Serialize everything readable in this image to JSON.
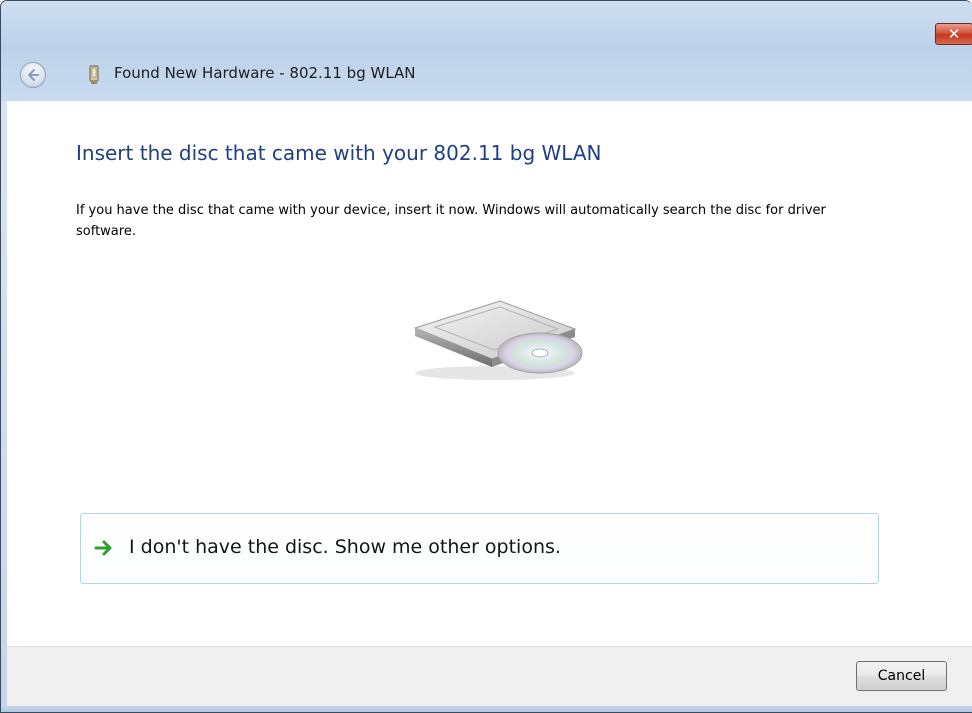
{
  "window": {
    "title": "Found New Hardware - 802.11 bg WLAN",
    "close_label": "x"
  },
  "main": {
    "heading": "Insert the disc that came with your 802.11 bg WLAN",
    "description": "If you have the disc that came with your device, insert it now.  Windows will automatically search the disc for driver software.",
    "option_label": "I don't have the disc.  Show me other options."
  },
  "footer": {
    "cancel_label": "Cancel"
  },
  "icons": {
    "back": "back-arrow-icon",
    "wizard": "hardware-device-icon",
    "drive": "disc-drive-icon",
    "option_arrow": "green-arrow-icon"
  },
  "colors": {
    "heading": "#1f3f87",
    "command_border": "#a9d9ee",
    "arrow": "#2aa02a",
    "close": "#c2391f"
  }
}
